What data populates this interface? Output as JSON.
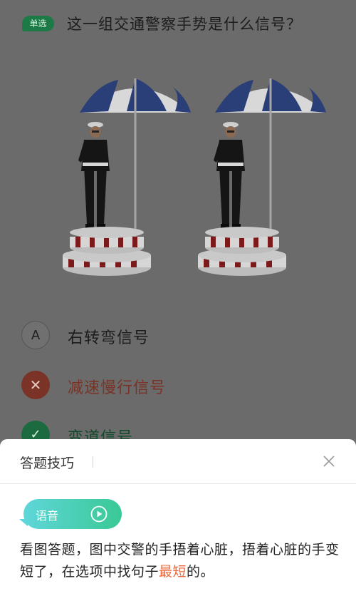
{
  "question": {
    "type_badge": "单选",
    "text": "这一组交通警察手势是什么信号？"
  },
  "options": [
    {
      "marker": "A",
      "label": "右转弯信号",
      "state": "default"
    },
    {
      "marker": "✕",
      "label": "减速慢行信号",
      "state": "wrong"
    },
    {
      "marker": "✓",
      "label": "变道信号",
      "state": "correct"
    }
  ],
  "sheet": {
    "title": "答题技巧",
    "voice_label": "语音",
    "tip_part1": "看图答题，图中交警的手捂着心脏，捂着心脏的手变短了，在选项中找句子",
    "tip_highlight": "最短",
    "tip_part2": "的。"
  },
  "colors": {
    "correct": "#1b7a46",
    "wrong": "#7a3326",
    "highlight": "#ea6a3c",
    "voice_gradient_start": "#5fd6d9",
    "voice_gradient_end": "#39c995"
  },
  "icons": {
    "close": "close-icon",
    "play": "play-icon",
    "wrong": "cross-icon",
    "correct": "check-icon"
  }
}
